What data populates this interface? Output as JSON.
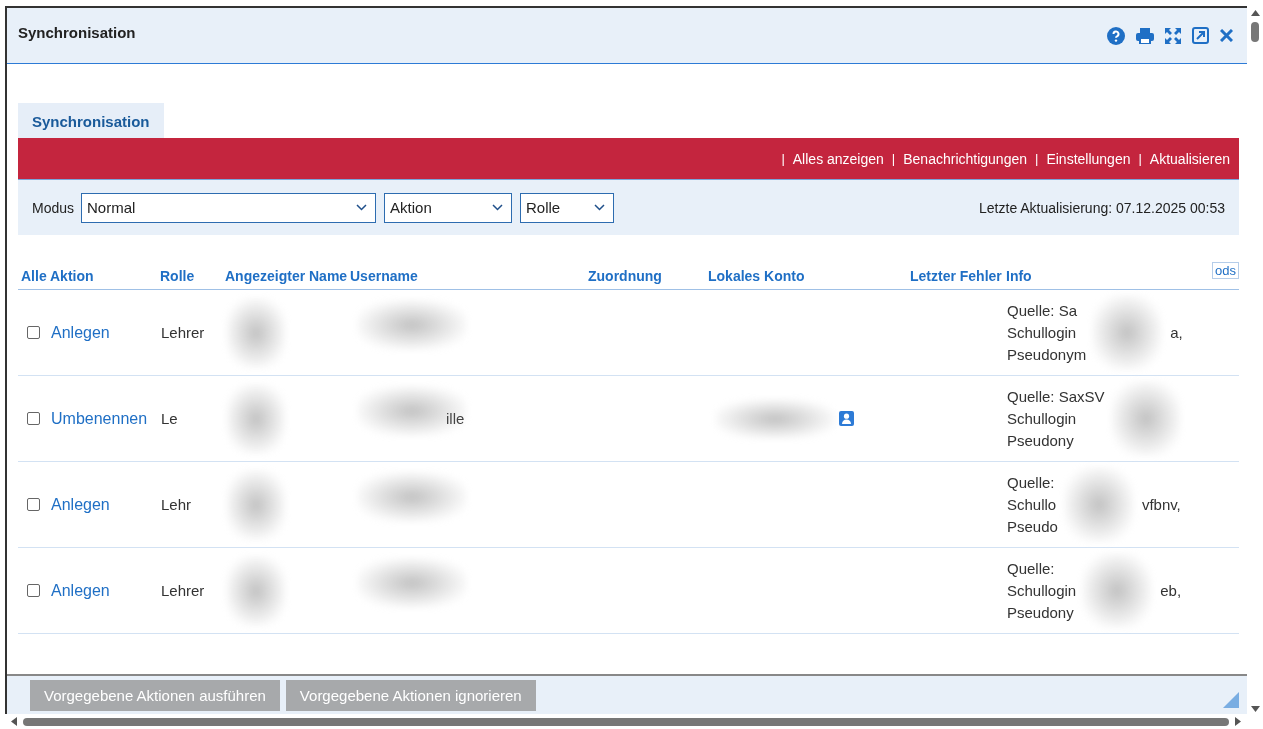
{
  "window": {
    "title": "Synchronisation"
  },
  "tabs": [
    {
      "label": "Synchronisation",
      "selected": true
    }
  ],
  "action_links": [
    {
      "separator": "|",
      "label": "Alles anzeigen"
    },
    {
      "separator": "|",
      "label": "Benachrichtigungen"
    },
    {
      "separator": "|",
      "label": "Einstellungen"
    },
    {
      "separator": "|",
      "label": "Aktualisieren"
    }
  ],
  "filters": {
    "label": "Modus",
    "selects": [
      {
        "value": "Normal"
      },
      {
        "value": "Aktion"
      },
      {
        "value": "Rolle"
      }
    ],
    "last_update": "Letzte Aktualisierung: 07.12.2025 00:53"
  },
  "table": {
    "columns": [
      "Alle",
      "Aktion",
      "Rolle",
      "Angezeigter Name",
      "Username",
      "Zuordnung",
      "Lokales Konto",
      "Letzter Fehler",
      "Info"
    ],
    "corner_label": "ods",
    "rows": [
      {
        "checked": false,
        "action": "Anlegen",
        "role": "Lehrer",
        "username": "",
        "account_icon": false,
        "info": [
          "Quelle: Sa",
          "Schullogin",
          "Pseudonym"
        ],
        "info_tail": "a,"
      },
      {
        "checked": false,
        "action": "Umbenennen",
        "role": "Le",
        "username": "ille",
        "account_icon": true,
        "info": [
          "Quelle: SaxSV",
          "Schullogin",
          "Pseudony"
        ],
        "info_tail": ""
      },
      {
        "checked": false,
        "action": "Anlegen",
        "role": "Lehr",
        "username": "",
        "account_icon": false,
        "info": [
          "Quelle:",
          "Schullo",
          "Pseudo"
        ],
        "info_tail": "vfbnv,"
      },
      {
        "checked": false,
        "action": "Anlegen",
        "role": "Lehrer",
        "username": "",
        "account_icon": false,
        "info": [
          "Quelle:",
          "Schullogin",
          "Pseudony"
        ],
        "info_tail": "eb,"
      }
    ]
  },
  "footer_buttons": [
    {
      "label": "Vorgegebene Aktionen ausführen",
      "disabled": true
    },
    {
      "label": "Vorgegebene Aktionen ignorieren",
      "disabled": true
    }
  ]
}
